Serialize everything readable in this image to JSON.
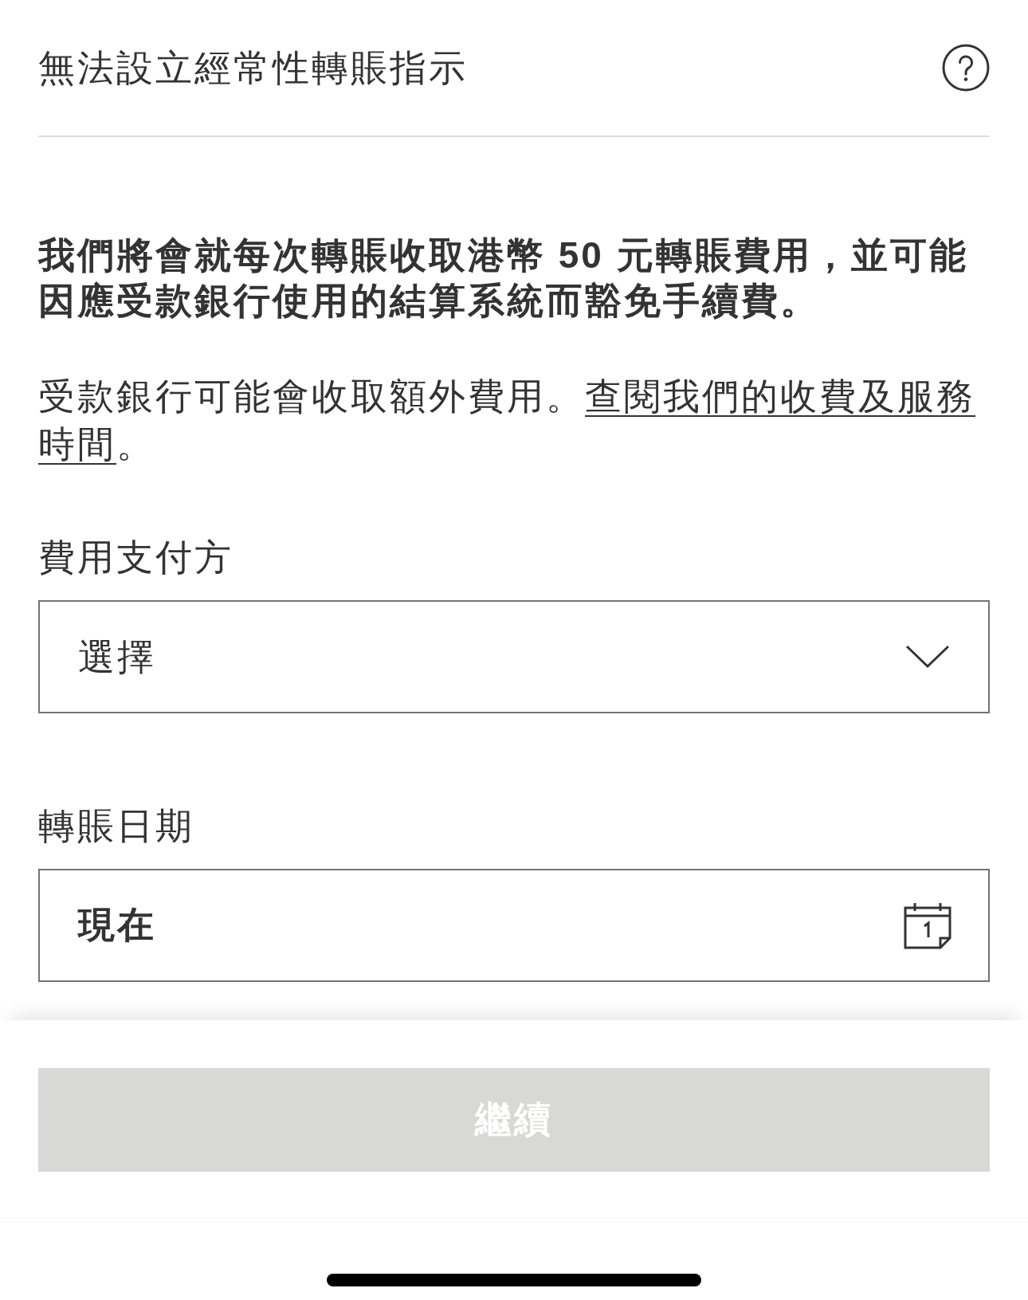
{
  "header": {
    "title": "無法設立經常性轉賬指示"
  },
  "notice": {
    "text": "我們將會就每次轉賬收取港幣 50 元轉賬費用，並可能因應受款銀行使用的結算系統而豁免手續費。"
  },
  "fee_info": {
    "text_before": "受款銀行可能會收取額外費用。",
    "link_lines": [
      "查閱我們的收費及服務",
      "時間"
    ],
    "text_after": "。"
  },
  "fields": [
    {
      "kind": "select",
      "label": "費用支付方",
      "placeholder": "選擇"
    },
    {
      "kind": "date",
      "label": "轉賬日期",
      "value": "現在"
    }
  ],
  "continue_button": {
    "label": "繼續",
    "disabled": true
  }
}
